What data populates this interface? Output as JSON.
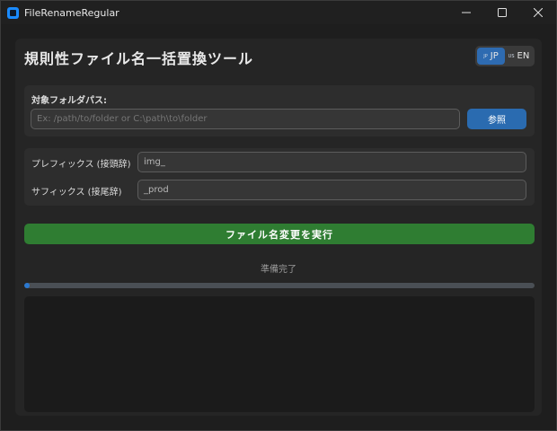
{
  "window": {
    "title": "FileRenameRegular",
    "controls": [
      "minimize-icon",
      "maximize-icon",
      "close-icon"
    ]
  },
  "header": {
    "title": "規則性ファイル名一括置換ツール"
  },
  "language_toggle": {
    "options": [
      {
        "flag": "JP",
        "label": "JP",
        "active": true
      },
      {
        "flag": "US",
        "label": "EN",
        "active": false
      }
    ],
    "active_color": "#2e6bb1"
  },
  "folder": {
    "label": "対象フォルダパス:",
    "placeholder": "Ex: /path/to/folder or C:\\path\\to\\folder",
    "value": "",
    "browse_label": "参照"
  },
  "prefix": {
    "label": "プレフィックス (接頭辞)",
    "value": "img_"
  },
  "suffix": {
    "label": "サフィックス (接尾辞)",
    "value": "_prod"
  },
  "run_button": {
    "label": "ファイル名変更を実行",
    "color": "#2f7d32"
  },
  "status": {
    "text": "準備完了",
    "progress": 0.01
  },
  "log": {
    "text": ""
  },
  "colors": {
    "accent": "#2a6bb0",
    "background": "#1e1e1e",
    "panel": "#2d2d2d"
  }
}
